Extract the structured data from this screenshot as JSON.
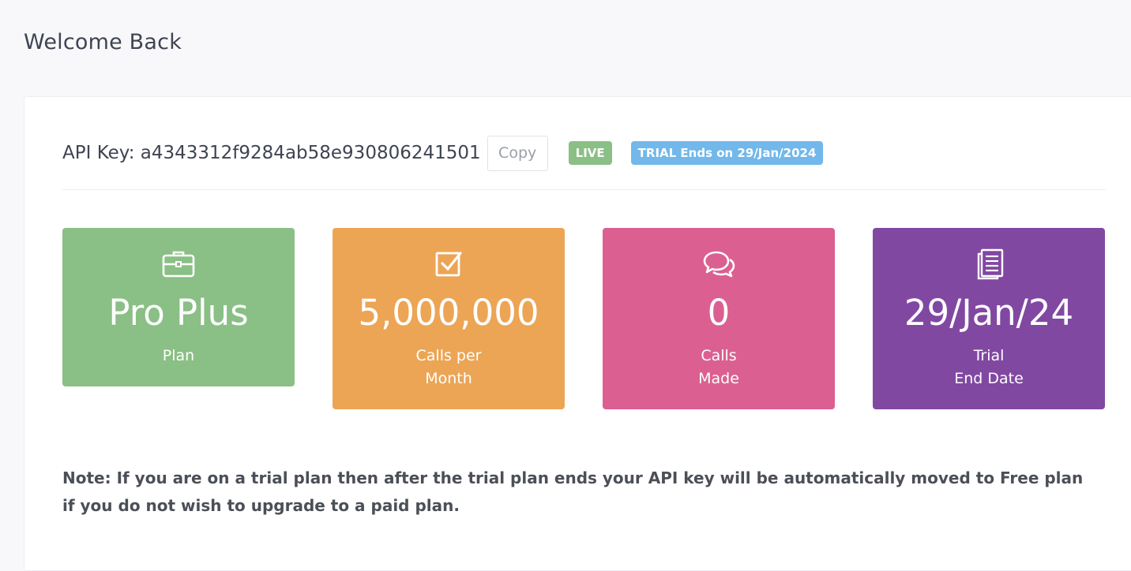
{
  "header": {
    "title": "Welcome Back"
  },
  "api": {
    "label": "API Key: a4343312f9284ab58e930806241501",
    "copy_label": "Copy",
    "status_badge": "LIVE",
    "trial_badge": "TRIAL Ends on 29/Jan/2024"
  },
  "stats": [
    {
      "icon": "briefcase-icon",
      "value": "Pro Plus",
      "label_line1": "Plan",
      "label_line2": "",
      "color": "#8abf85"
    },
    {
      "icon": "checkbox-icon",
      "value": "5,000,000",
      "label_line1": "Calls per",
      "label_line2": "Month",
      "color": "#eca555"
    },
    {
      "icon": "chat-bubbles-icon",
      "value": "0",
      "label_line1": "Calls",
      "label_line2": "Made",
      "color": "#db6091"
    },
    {
      "icon": "document-icon",
      "value": "29/Jan/24",
      "label_line1": "Trial",
      "label_line2": "End Date",
      "color": "#8148a2"
    }
  ],
  "note": "Note: If you are on a trial plan then after the trial plan ends your API key will be automatically moved to Free plan if you do not wish to upgrade to a paid plan."
}
